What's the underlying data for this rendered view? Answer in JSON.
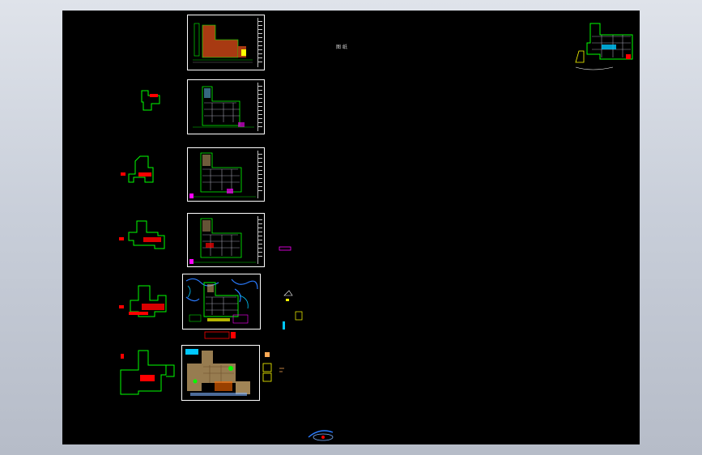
{
  "canvas": {
    "background": "#000000",
    "frame_background": "#c8ced9"
  },
  "annotations": {
    "center_text": "图 纸",
    "red_tags": [
      "",
      ""
    ]
  },
  "colors": {
    "sheet_border": "#ffffff",
    "plan_outline": "#00ff00",
    "tag_red": "#ff0000",
    "wall_gray": "#9a9aa8",
    "fill_brown": "#a83a12",
    "fill_cyan": "#00c8ff",
    "fill_yellow": "#ffff00",
    "fill_magenta": "#ff00ff",
    "fill_tan": "#c9a66b"
  },
  "icons": [
    "compass-logo-icon"
  ]
}
